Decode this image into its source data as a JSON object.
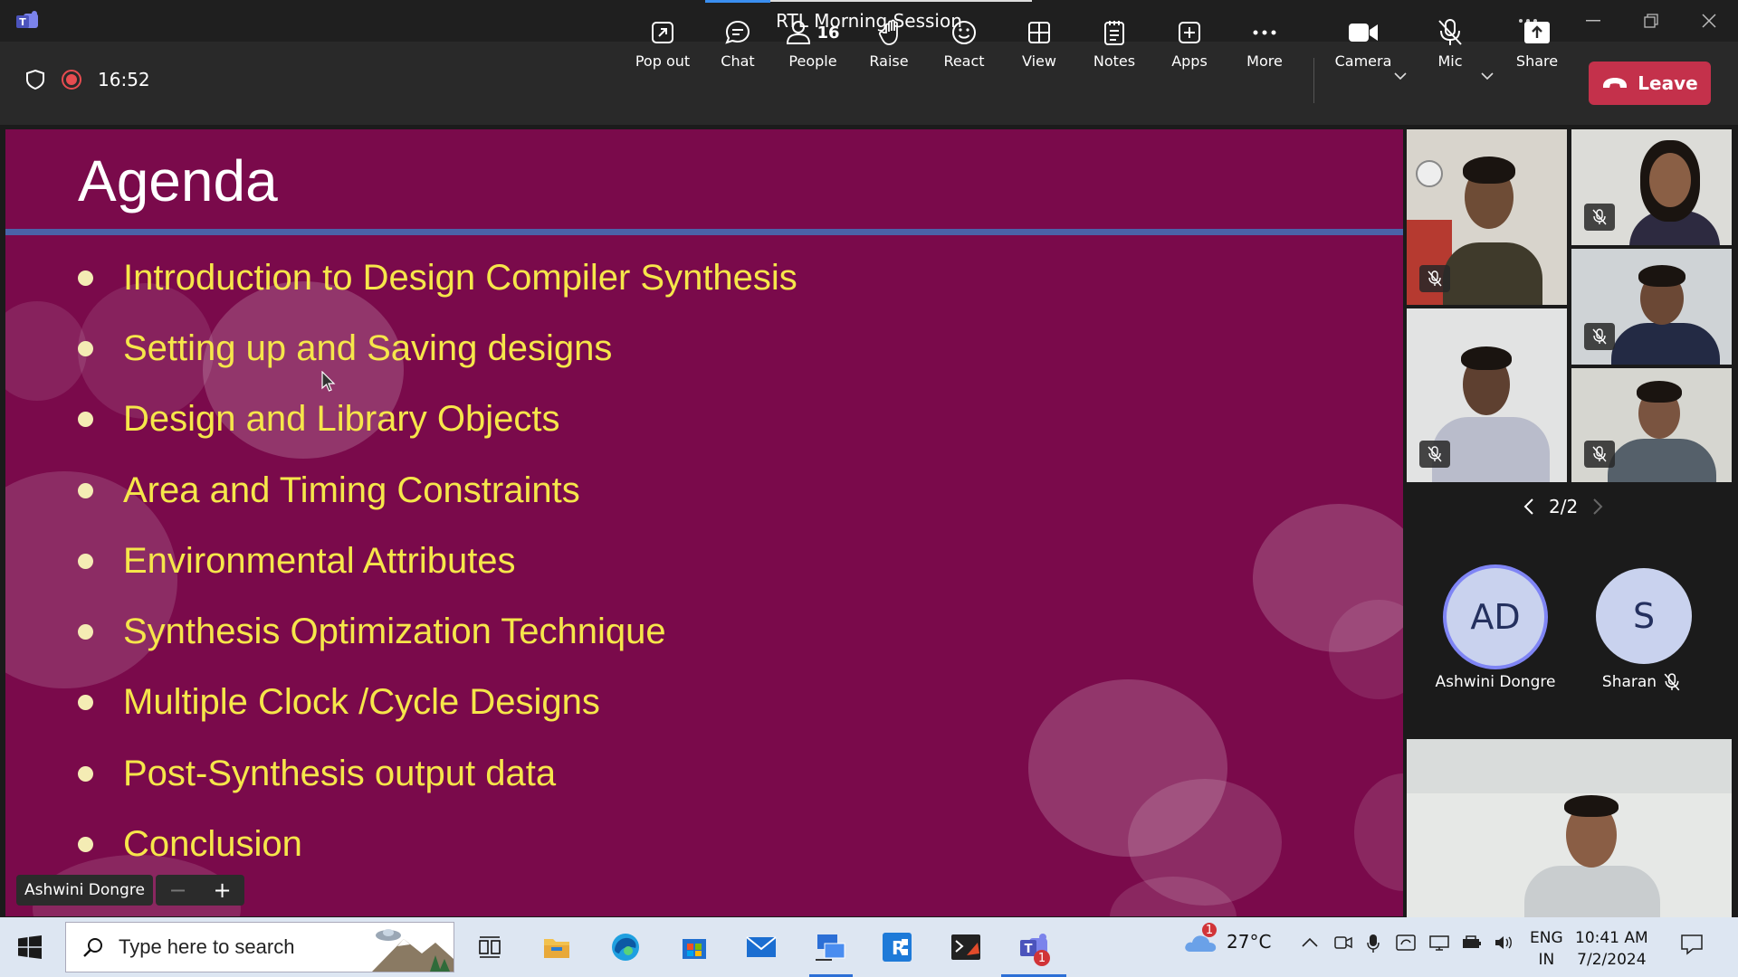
{
  "window": {
    "title": "RTL Morning Session"
  },
  "meeting": {
    "timer": "16:52"
  },
  "toolbar": {
    "pop_out": "Pop out",
    "chat": "Chat",
    "people": "People",
    "people_count": "16",
    "raise": "Raise",
    "react": "React",
    "view": "View",
    "notes": "Notes",
    "apps": "Apps",
    "more": "More",
    "camera": "Camera",
    "mic": "Mic",
    "share": "Share",
    "leave": "Leave"
  },
  "slide": {
    "title": "Agenda",
    "items": [
      "Introduction to  Design Compiler Synthesis",
      "Setting up and Saving designs",
      "Design and Library Objects",
      "Area and Timing Constraints",
      "Environmental Attributes",
      "Synthesis Optimization Technique",
      "Multiple Clock /Cycle Designs",
      "Post-Synthesis output data",
      "Conclusion"
    ],
    "presenter": "Ashwini Dongre",
    "zoom_out": "−",
    "zoom_in": "+"
  },
  "gallery": {
    "page": "2/2",
    "avatars": [
      {
        "initials": "AD",
        "name": "Ashwini Dongre"
      },
      {
        "initials": "S",
        "name": "Sharan"
      }
    ]
  },
  "taskbar": {
    "search_placeholder": "Type here to search",
    "weather_temp": "27°C",
    "weather_badge": "1",
    "teams_badge": "1",
    "lang_1": "ENG",
    "lang_2": "IN",
    "time": "10:41 AM",
    "date": "7/2/2024"
  },
  "colors": {
    "slide_background": "#7a0a4b",
    "agenda_text": "#f6e64a",
    "title_rule": "#4a63a8",
    "leave_button": "#c4314b",
    "recording": "#e74c50"
  },
  "icons": {
    "toolbar": [
      "pop-out-icon",
      "chat-icon",
      "people-icon",
      "raise-hand-icon",
      "react-icon",
      "view-icon",
      "notes-icon",
      "apps-icon",
      "more-icon",
      "camera-icon",
      "mic-off-icon",
      "share-icon",
      "phone-hangup-icon"
    ]
  }
}
